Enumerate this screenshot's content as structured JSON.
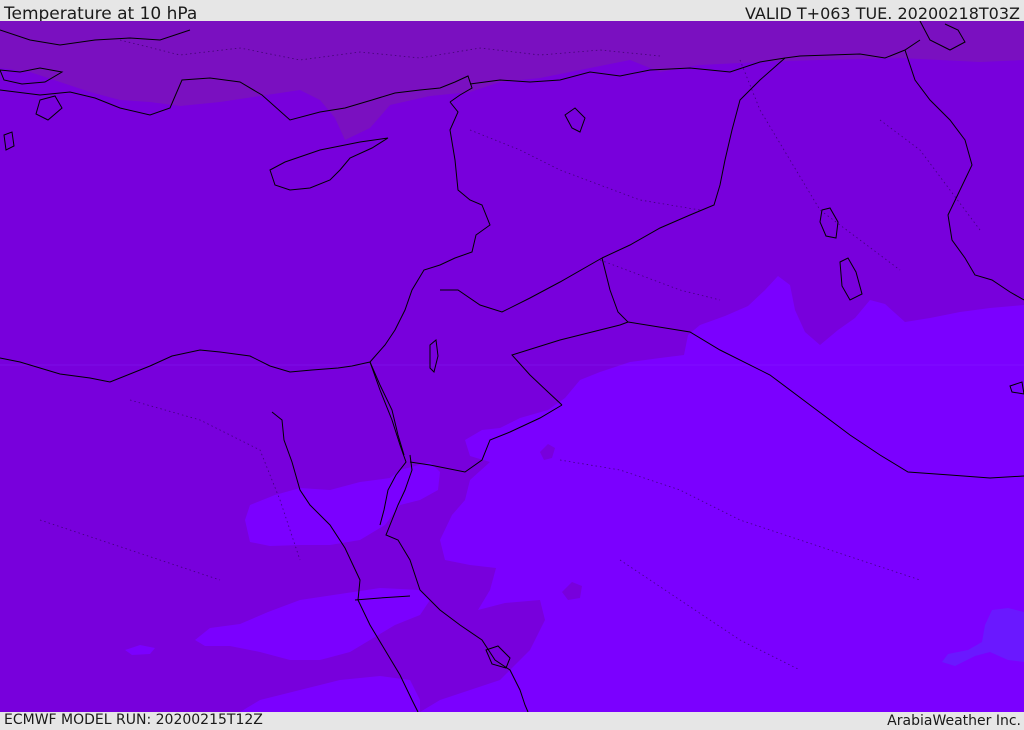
{
  "header": {
    "title": "Temperature at 10 hPa",
    "valid": "VALID T+063 TUE. 20200218T03Z"
  },
  "footer": {
    "model_run": "ECMWF MODEL RUN: 20200215T12Z",
    "credit": "ArabiaWeather Inc."
  },
  "map": {
    "field": "Temperature at 10 hPa",
    "colors": {
      "cold_fill": "#7b00ff",
      "mid_fill": "#7800dc",
      "warm_fill": "#7a10c0",
      "coolest_patch": "#6a18ff",
      "coastline": "#000000",
      "borders": "#000000"
    }
  }
}
